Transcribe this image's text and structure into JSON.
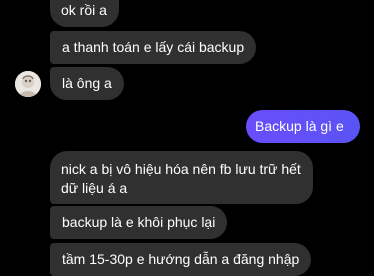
{
  "messages": [
    {
      "text": "ok rồi a"
    },
    {
      "text": "a thanh toán e lấy cái backup"
    },
    {
      "text": "là ông a"
    },
    {
      "text": "Backup là gì e"
    },
    {
      "line1": "nick a bị vô hiệu hóa nên fb lưu trữ hết",
      "line2": "dữ liệu á a"
    },
    {
      "text": "backup là e khôi phục lại"
    },
    {
      "text": "tầm 15-30p e hướng dẫn a đăng nhập"
    }
  ],
  "colors": {
    "background": "#000000",
    "incoming_bubble": "#303030",
    "outgoing_gradient_start": "#6a4dfb",
    "outgoing_gradient_end": "#5a54f3",
    "text": "#ffffff"
  },
  "icons": {
    "avatar": "contact-avatar"
  }
}
